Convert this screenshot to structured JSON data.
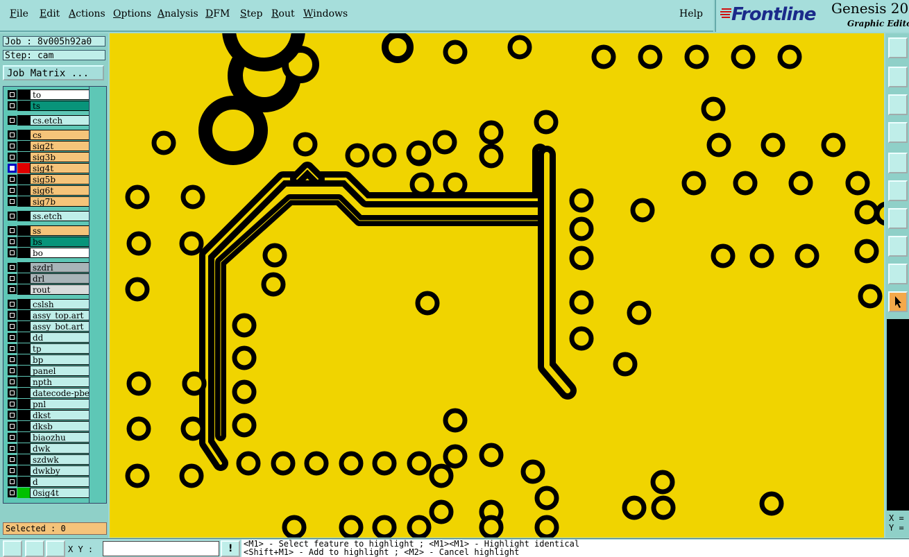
{
  "menu": [
    "File",
    "Edit",
    "Actions",
    "Options",
    "Analysis",
    "DFM",
    "Step",
    "Rout",
    "Windows"
  ],
  "help": "Help",
  "brand": {
    "logo": "Frontline",
    "product": "Genesis 20",
    "subtitle": "Graphic Editor"
  },
  "job": {
    "job_label": "Job : 8v005h92a0",
    "step_label": "Step: cam",
    "matrix_button": "Job Matrix ..."
  },
  "layers": [
    {
      "name": "to",
      "color": "#000000",
      "bg": "#ffffff"
    },
    {
      "name": "ts",
      "color": "#000000",
      "bg": "#08947a"
    },
    {
      "name": "cs.etch",
      "color": "#000000",
      "bg": "#bfeee9"
    },
    {
      "name": "cs",
      "color": "#000000",
      "bg": "#f5c47a"
    },
    {
      "name": "sig2t",
      "color": "#000000",
      "bg": "#f5c47a"
    },
    {
      "name": "sig3b",
      "color": "#000000",
      "bg": "#f5c47a"
    },
    {
      "name": "sig4t",
      "color": "#e00000",
      "bg": "#f5c47a",
      "selected": true
    },
    {
      "name": "sig5b",
      "color": "#000000",
      "bg": "#f5c47a"
    },
    {
      "name": "sig6t",
      "color": "#000000",
      "bg": "#f5c47a"
    },
    {
      "name": "sig7b",
      "color": "#000000",
      "bg": "#f5c47a"
    },
    {
      "name": "ss.etch",
      "color": "#000000",
      "bg": "#bfeee9"
    },
    {
      "name": "ss",
      "color": "#000000",
      "bg": "#f5c47a"
    },
    {
      "name": "bs",
      "color": "#000000",
      "bg": "#08947a"
    },
    {
      "name": "bo",
      "color": "#000000",
      "bg": "#ffffff"
    },
    {
      "name": "szdrl",
      "color": "#000000",
      "bg": "#a8b4b8"
    },
    {
      "name": "drl",
      "color": "#000000",
      "bg": "#a8b4b8"
    },
    {
      "name": "rout",
      "color": "#000000",
      "bg": "#d8dcdc"
    },
    {
      "name": "cslsh",
      "color": "#000000",
      "bg": "#bfeee9"
    },
    {
      "name": "assy_top.art",
      "color": "#000000",
      "bg": "#bfeee9"
    },
    {
      "name": "assy_bot.art",
      "color": "#000000",
      "bg": "#bfeee9"
    },
    {
      "name": "dd",
      "color": "#000000",
      "bg": "#bfeee9"
    },
    {
      "name": "tp",
      "color": "#000000",
      "bg": "#bfeee9"
    },
    {
      "name": "bp",
      "color": "#000000",
      "bg": "#bfeee9"
    },
    {
      "name": "panel",
      "color": "#000000",
      "bg": "#bfeee9"
    },
    {
      "name": "npth",
      "color": "#000000",
      "bg": "#bfeee9"
    },
    {
      "name": "datecode-pbe",
      "color": "#000000",
      "bg": "#bfeee9"
    },
    {
      "name": "pnl",
      "color": "#000000",
      "bg": "#bfeee9"
    },
    {
      "name": "dkst",
      "color": "#000000",
      "bg": "#bfeee9"
    },
    {
      "name": "dksb",
      "color": "#000000",
      "bg": "#bfeee9"
    },
    {
      "name": "biaozhu",
      "color": "#000000",
      "bg": "#bfeee9"
    },
    {
      "name": "dwk",
      "color": "#000000",
      "bg": "#bfeee9"
    },
    {
      "name": "szdwk",
      "color": "#000000",
      "bg": "#bfeee9"
    },
    {
      "name": "dwkby",
      "color": "#000000",
      "bg": "#bfeee9"
    },
    {
      "name": "d",
      "color": "#000000",
      "bg": "#bfeee9"
    },
    {
      "name": "0sig4t",
      "color": "#00c000",
      "bg": "#bfeee9"
    }
  ],
  "selected": "Selected : 0",
  "xy_label": "X Y :",
  "status_lines": [
    "<M1> - Select feature to highlight ; <M1><M1> - Highlight identical",
    "<Shift+M1> - Add to highlight ; <M2> - Cancel highlight"
  ],
  "coord_labels": {
    "x": "X =",
    "y": "Y ="
  },
  "colors": {
    "board": "#f0d400",
    "copper": "#000000",
    "panel": "#8fd0c8"
  }
}
